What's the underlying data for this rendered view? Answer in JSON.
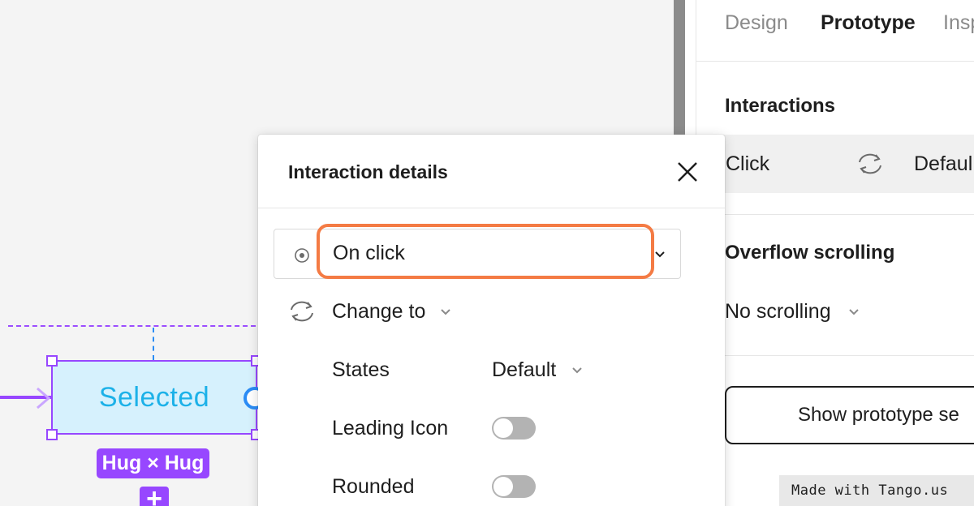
{
  "canvas": {
    "frame_text": "Selected",
    "size_badge": "Hug × Hug",
    "add_symbol": "+",
    "selection_color": "#9747ff",
    "frame_fill": "#d6f1fd"
  },
  "panel": {
    "tabs": [
      {
        "label": "Design",
        "active": false
      },
      {
        "label": "Prototype",
        "active": true
      },
      {
        "label": "Insp",
        "active": false
      }
    ],
    "interactions_title": "Interactions",
    "interaction": {
      "trigger": "Click",
      "icon": "change-to-icon",
      "destination": "Defaul"
    },
    "overflow_title": "Overflow scrolling",
    "overflow_value": "No scrolling",
    "prototype_button": "Show prototype se"
  },
  "modal": {
    "title": "Interaction details",
    "trigger_value": "On click",
    "action_label": "Change to",
    "states_label": "States",
    "states_value": "Default",
    "leading_icon_label": "Leading Icon",
    "leading_icon_on": false,
    "rounded_label": "Rounded",
    "rounded_on": false,
    "highlight_color": "#f47b44"
  },
  "watermark": "Made with Tango.us"
}
